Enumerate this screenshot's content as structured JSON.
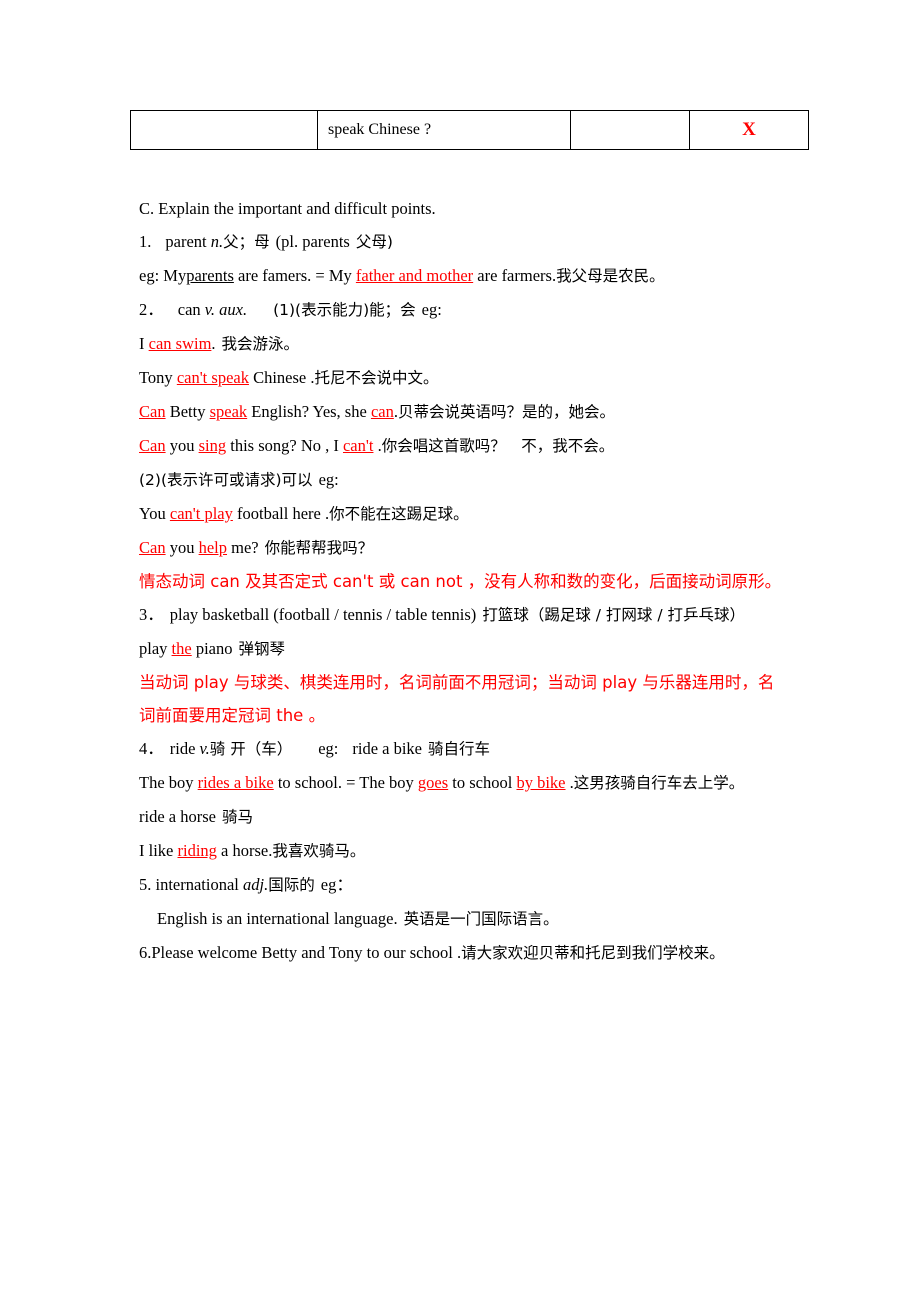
{
  "document": {
    "table": {
      "rows": [
        {
          "cells": [
            {
              "text": "",
              "name": "table-cell-blank-left"
            },
            {
              "text": "speak Chinese ?",
              "name": "table-cell-question"
            },
            {
              "text": "",
              "name": "table-cell-blank-middle"
            },
            {
              "text": "X",
              "name": "table-cell-mark",
              "color": "#ff0000"
            }
          ]
        }
      ]
    },
    "heading": "C. Explain the important and difficult points.",
    "entries": {
      "item1_number": "1.",
      "item1_word": "parent",
      "item1_pos": "n.",
      "item1_cn": "父；母",
      "item1_plural": "(pl. parents",
      "item1_plural_cn": "父母)",
      "eg1_prefix": "eg: My",
      "eg1_underline_black": "parents",
      "eg1_mid": "are famers. = My",
      "eg1_underline_red": "father and mother",
      "eg1_suffix": "are farmers.",
      "eg1_cn": "我父母是农民。",
      "item2_number": "2．",
      "item2_word": "can",
      "item2_pos": "v. aux.",
      "item2_sense1": "(1)(表示能力)能；会",
      "item2_eg": "eg:",
      "l1_a": "I",
      "l1_red": "can swim",
      "l1_b": ".",
      "l1_cn": "我会游泳。",
      "l2_a": "Tony",
      "l2_red": "can't speak",
      "l2_b": "Chinese .",
      "l2_cn": "托尼不会说中文。",
      "l3_red1": "Can",
      "l3_a": "Betty",
      "l3_red2": "speak",
      "l3_b": "English? Yes, she",
      "l3_red3": "can",
      "l3_c": ".",
      "l3_cn": "贝蒂会说英语吗？是的，她会。",
      "l4_red1": "Can",
      "l4_a": "you",
      "l4_red2": "sing",
      "l4_b": "this song? No , I",
      "l4_red3": "can't",
      "l4_c": ".",
      "l4_cn": "你会唱这首歌吗？　不，我不会。",
      "item2_sense2": "(2)(表示许可或请求)可以",
      "item2_sense2_eg": "eg:",
      "l5_a": "You",
      "l5_red": "can't play",
      "l5_b": "football here .",
      "l5_cn": "你不能在这踢足球。",
      "l6_red1": "Can",
      "l6_a": "you",
      "l6_red2": "help",
      "l6_b": "me?",
      "l6_cn": "你能帮帮我吗？",
      "note_can": "情态动词 can 及其否定式 can't 或  can not ，没有人称和数的变化，后面接动词原形。",
      "item3_number": "3．",
      "item3_en": "play basketball (football / tennis / table tennis)",
      "item3_cn": "打篮球（踢足球 / 打网球 / 打乒乓球）",
      "l7_a": "play",
      "l7_red": "the",
      "l7_b": "piano",
      "l7_cn": "弹钢琴",
      "note_play": "当动词 play 与球类、棋类连用时，名词前面不用冠词；当动词 play 与乐器连用时，名词前面要用定冠词 the 。",
      "item4_number": "4．",
      "item4_word": "ride",
      "item4_pos": "v.",
      "item4_cn": "骑 开（车）",
      "item4_eg": "eg:",
      "item4_phrase": "ride a bike",
      "item4_phrase_cn": "骑自行车",
      "l8_a": "The boy",
      "l8_red1": "rides a bike",
      "l8_b": "to school. = The boy",
      "l8_red2": "goes",
      "l8_c": "to school",
      "l8_red3": "by bike",
      "l8_d": ".",
      "l8_cn": "这男孩骑自行车去上学。",
      "l9_en": "ride a horse",
      "l9_cn": "骑马",
      "l10_a": "I like",
      "l10_red": "riding",
      "l10_b": "a horse.",
      "l10_cn": "我喜欢骑马。",
      "item5_number": "5.",
      "item5_word": "international",
      "item5_pos": "adj.",
      "item5_cn": "国际的",
      "item5_eg": "eg：",
      "item5_sentence": "English is an international language.",
      "item5_sentence_cn": "英语是一门国际语言。",
      "item6_number": "6.",
      "item6_sentence": "Please welcome Betty and Tony to our school .",
      "item6_cn": "请大家欢迎贝蒂和托尼到我们学校来。"
    }
  }
}
